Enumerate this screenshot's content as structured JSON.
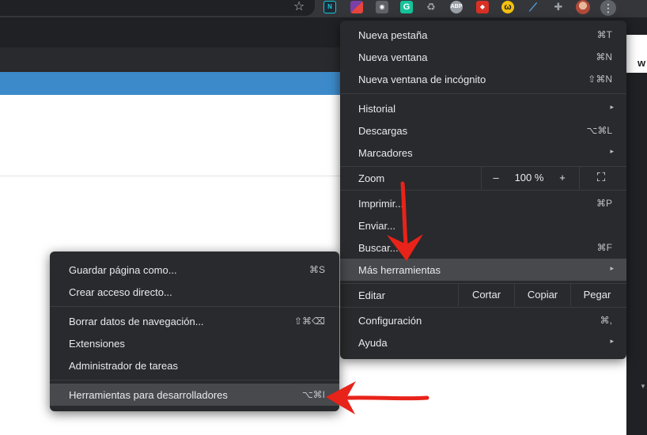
{
  "browser": {
    "star_icon": "☆",
    "extensions": [
      {
        "name": "n-ext",
        "text": "N",
        "color": "#17a2b8"
      },
      {
        "name": "flag-ext",
        "text": "",
        "color": "#7b3fa8"
      },
      {
        "name": "bulb-ext",
        "text": "◉",
        "color": "#5f6368"
      },
      {
        "name": "grammarly-ext",
        "text": "G",
        "color": "#15c39a"
      },
      {
        "name": "recycle-ext",
        "text": "♻",
        "color": "#35363a"
      },
      {
        "name": "abp-ext",
        "text": "ABP",
        "color": "#9aa0a6"
      },
      {
        "name": "shield-ext",
        "text": "◆",
        "color": "#d93025"
      },
      {
        "name": "w-ext",
        "text": "ω",
        "color": "#f4c20d"
      },
      {
        "name": "tool-ext",
        "text": "⟋",
        "color": "#35363a"
      },
      {
        "name": "puzzle-ext",
        "text": "✚",
        "color": "#35363a"
      }
    ],
    "kebab": "⋮",
    "side_panel_char": "w",
    "side_panel_caret": "▼"
  },
  "main_menu": {
    "items": [
      {
        "label": "Nueva pestaña",
        "shortcut": "⌘T"
      },
      {
        "label": "Nueva ventana",
        "shortcut": "⌘N"
      },
      {
        "label": "Nueva ventana de incógnito",
        "shortcut": "⇧⌘N"
      },
      {
        "label": "Historial",
        "submenu": "▸"
      },
      {
        "label": "Descargas",
        "shortcut": "⌥⌘L"
      },
      {
        "label": "Marcadores",
        "submenu": "▸"
      },
      {
        "label": "Imprimir...",
        "shortcut": "⌘P"
      },
      {
        "label": "Enviar..."
      },
      {
        "label": "Buscar...",
        "shortcut": "⌘F"
      },
      {
        "label": "Más herramientas",
        "submenu": "▸"
      },
      {
        "label": "Configuración",
        "shortcut": "⌘,"
      },
      {
        "label": "Ayuda",
        "submenu": "▸"
      }
    ],
    "zoom": {
      "label": "Zoom",
      "minus": "–",
      "value": "100 %",
      "plus": "+",
      "fullscreen": "⛶"
    },
    "edit": {
      "label": "Editar",
      "cut": "Cortar",
      "copy": "Copiar",
      "paste": "Pegar"
    }
  },
  "sub_menu": {
    "items": [
      {
        "label": "Guardar página como...",
        "shortcut": "⌘S"
      },
      {
        "label": "Crear acceso directo..."
      },
      {
        "label": "Borrar datos de navegación...",
        "shortcut": "⇧⌘⌫"
      },
      {
        "label": "Extensiones"
      },
      {
        "label": "Administrador de tareas"
      },
      {
        "label": "Herramientas para desarrolladores",
        "shortcut": "⌥⌘I"
      }
    ]
  },
  "colors": {
    "annotation_arrow": "#e8231a",
    "menu_bg": "#292a2d",
    "highlight": "#48494d"
  }
}
